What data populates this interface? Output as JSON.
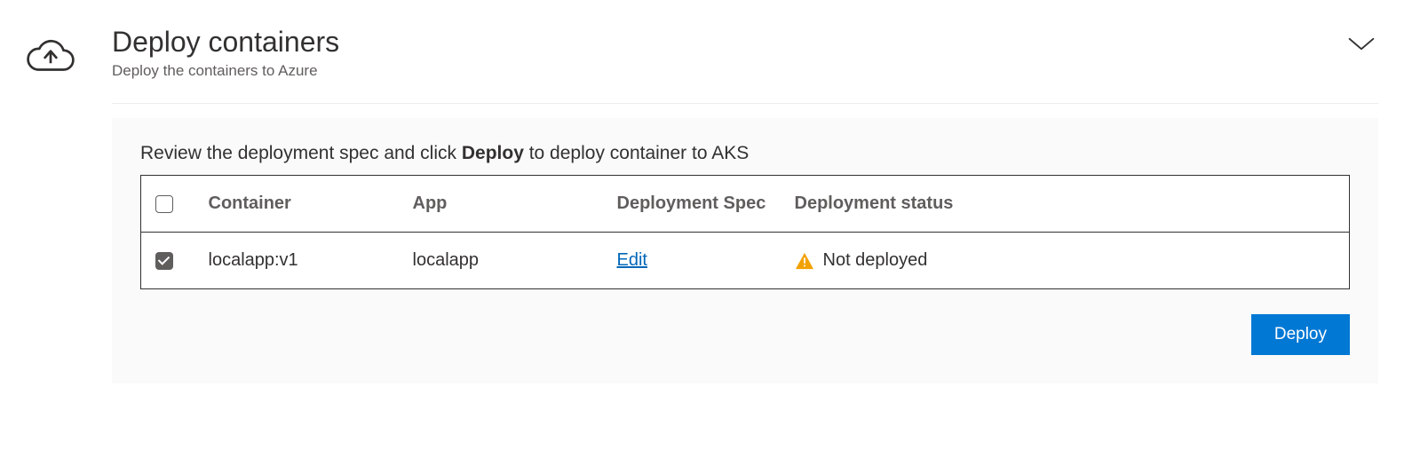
{
  "header": {
    "title": "Deploy containers",
    "subtitle": "Deploy the containers to Azure"
  },
  "instruction": {
    "prefix": "Review the deployment spec and click ",
    "bold": "Deploy",
    "suffix": " to deploy container to AKS"
  },
  "table": {
    "headers": {
      "container": "Container",
      "app": "App",
      "spec": "Deployment Spec",
      "status": "Deployment status"
    },
    "rows": [
      {
        "checked": true,
        "container": "localapp:v1",
        "app": "localapp",
        "spec_link": "Edit",
        "status": "Not deployed"
      }
    ]
  },
  "actions": {
    "deploy": "Deploy"
  }
}
